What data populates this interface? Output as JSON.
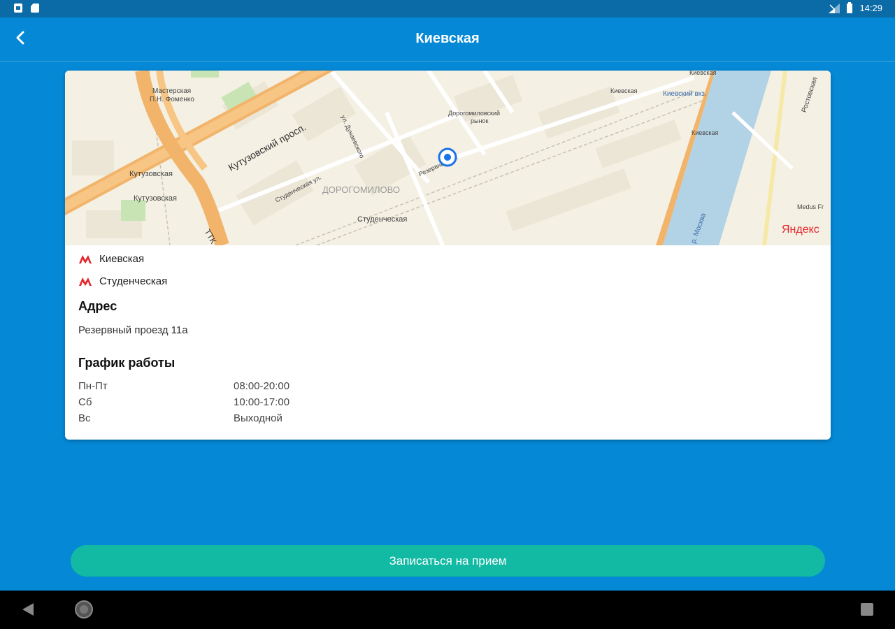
{
  "status_bar": {
    "time": "14:29",
    "icons": [
      "notification-icon",
      "sd-card-icon",
      "signal-icon",
      "battery-icon"
    ]
  },
  "app_bar": {
    "title": "Киевская",
    "back_icon": "chevron-left-icon"
  },
  "map": {
    "labels": {
      "prospect": "Кутузовский просп.",
      "district": "ДОРОГОМИЛОВО",
      "kutuzovskaya_1": "Кутузовская",
      "kutuzovskaya_2": "Кутузовская",
      "studencheskaya": "Студенческая",
      "masterskaya": "Мастерская",
      "fomenko": "П.Н. Фоменко",
      "studencheskaya_st": "Студенческая ул.",
      "dorogomilovsky": "Дорогомиловский",
      "rynok": "рынок",
      "kievskaya_top": "Киевская",
      "kievskaya_mid": "Киевская",
      "kievsky_vokzal": "Киевский вкз.",
      "kievskaya_right": "Киевская",
      "ttk": "ТТК",
      "moskva_river": "р. Москва",
      "medus": "Medus Fr",
      "reservny": "Резервный пр.",
      "dunaevskogo": "ул. Дунаевского",
      "rostovskaya": "Ростовская",
      "yandex_logo": "Яндекс"
    }
  },
  "metro": [
    {
      "line_color": "#e4262c",
      "name": "Киевская"
    },
    {
      "line_color": "#e4262c",
      "name": "Студенческая"
    }
  ],
  "address": {
    "heading": "Адрес",
    "value": "Резервный проезд 11а"
  },
  "schedule": {
    "heading": "График работы",
    "rows": [
      {
        "day": "Пн-Пт",
        "hours": "08:00-20:00"
      },
      {
        "day": "Сб",
        "hours": "10:00-17:00"
      },
      {
        "day": "Вс",
        "hours": "Выходной"
      }
    ]
  },
  "cta": {
    "label": "Записаться на прием"
  },
  "colors": {
    "app_blue": "#0588d6",
    "status_blue": "#0a6ba7",
    "cta_teal": "#12b9a3",
    "metro_red": "#e4262c"
  }
}
